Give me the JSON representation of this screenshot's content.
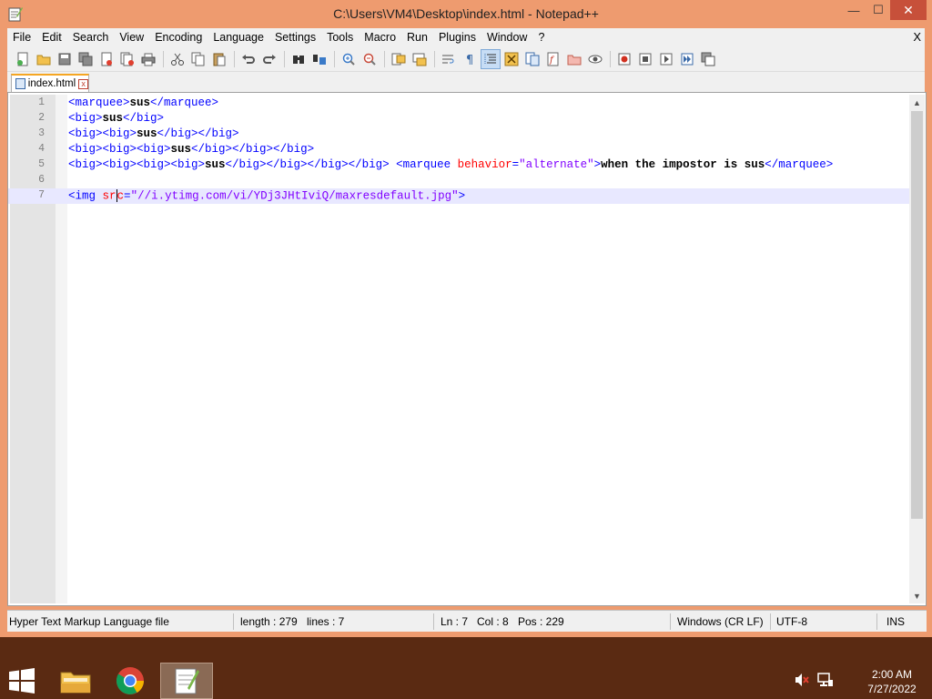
{
  "window": {
    "title": "C:\\Users\\VM4\\Desktop\\index.html - Notepad++",
    "min_label": "—",
    "max_label": "☐",
    "close_label": "✕"
  },
  "menu": {
    "items": [
      "File",
      "Edit",
      "Search",
      "View",
      "Encoding",
      "Language",
      "Settings",
      "Tools",
      "Macro",
      "Run",
      "Plugins",
      "Window",
      "?"
    ],
    "close_label": "X"
  },
  "toolbar": {
    "icons": [
      "new-file-icon",
      "open-file-icon",
      "save-icon",
      "save-all-icon",
      "close-icon",
      "close-all-icon",
      "print-icon",
      "cut-icon",
      "copy-icon",
      "paste-icon",
      "undo-icon",
      "redo-icon",
      "find-icon",
      "replace-icon",
      "zoom-in-icon",
      "zoom-out-icon",
      "sync-vertical-icon",
      "sync-horizontal-icon",
      "word-wrap-icon",
      "show-all-chars-icon",
      "indent-guide-icon",
      "udl-icon",
      "doc-map-icon",
      "function-list-icon",
      "folder-workspace-icon",
      "monitoring-icon",
      "record-macro-icon",
      "stop-macro-icon",
      "play-macro-icon",
      "run-macro-multiple-icon",
      "save-macro-icon"
    ]
  },
  "tab": {
    "label": "index.html",
    "close_label": "x"
  },
  "editor": {
    "lines": [
      {
        "num": "1"
      },
      {
        "num": "2"
      },
      {
        "num": "3"
      },
      {
        "num": "4"
      },
      {
        "num": "5"
      },
      {
        "num": "6"
      },
      {
        "num": "7"
      }
    ],
    "tokens": {
      "l1_open": "<marquee>",
      "l1_text": "sus",
      "l1_close": "</marquee>",
      "l2_open": "<big>",
      "l2_text": "sus",
      "l2_close": "</big>",
      "l3_open": "<big><big>",
      "l3_text": "sus",
      "l3_close": "</big></big>",
      "l4_open": "<big><big><big>",
      "l4_text": "sus",
      "l4_close": "</big></big></big>",
      "l5_open": "<big><big><big><big>",
      "l5_text": "sus",
      "l5_close": "</big></big></big></big>",
      "l5_space": " ",
      "l5_mq_open": "<marquee ",
      "l5_attr": "behavior",
      "l5_eq": "=",
      "l5_val": "\"alternate\"",
      "l5_gt": ">",
      "l5_mq_text": "when the impostor is sus",
      "l5_mq_close": "</marquee>",
      "l7_open": "<img ",
      "l7_attr_a": "sr",
      "l7_attr_b": "c",
      "l7_eq": "=",
      "l7_val": "\"//i.ytimg.com/vi/YDj3JHtIviQ/maxresdefault.jpg\"",
      "l7_gt": ">"
    }
  },
  "status": {
    "file_type": "Hyper Text Markup Language file",
    "length": "length : 279",
    "lines": "lines : 7",
    "ln": "Ln : 7",
    "col": "Col : 8",
    "pos": "Pos : 229",
    "eol": "Windows (CR LF)",
    "encoding": "UTF-8",
    "mode": "INS"
  },
  "taskbar": {
    "clock_time": "2:00 AM",
    "clock_date": "7/27/2022"
  },
  "colors": {
    "frame": "#ee9b6f",
    "taskbar": "#5a2a12",
    "tag": "#0000ff",
    "attribute": "#ff0000",
    "value": "#8000ff",
    "current_line": "#e8e8ff"
  }
}
